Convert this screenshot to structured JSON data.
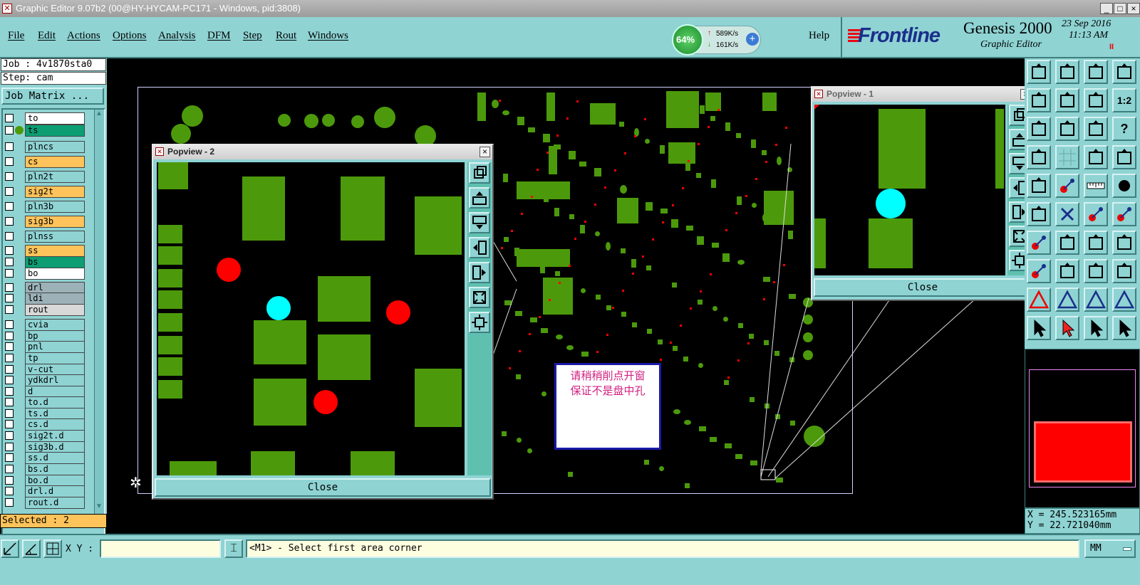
{
  "window": {
    "title": "Graphic Editor 9.07b2 (00@HY-HYCAM-PC171 - Windows, pid:3808)",
    "min": "_",
    "max": "□",
    "close": "×"
  },
  "menu": {
    "items": [
      "File",
      "Edit",
      "Actions",
      "Options",
      "Analysis",
      "DFM",
      "Step",
      "Rout",
      "Windows"
    ],
    "help": "Help"
  },
  "netmeter": {
    "percent": "64%",
    "up": "589K/s",
    "down": "161K/s",
    "plus": "+"
  },
  "brand": {
    "logo": "Frontline",
    "product": "Genesis 2000",
    "subtitle": "Graphic Editor",
    "date": "23 Sep 2016",
    "time": "11:13 AM",
    "pause": "II"
  },
  "job": {
    "job_label": "Job : 4v1870sta0",
    "step_label": "Step: cam",
    "matrix_button": "Job Matrix ..."
  },
  "layers": [
    {
      "name": "to",
      "color": "#ffffff"
    },
    {
      "name": "ts",
      "color": "#0d9e73"
    },
    {
      "name": "plncs",
      "color": "#8fd3d3"
    },
    {
      "name": "cs",
      "color": "#fec35a"
    },
    {
      "name": "pln2t",
      "color": "#8fd3d3"
    },
    {
      "name": "sig2t",
      "color": "#fec35a"
    },
    {
      "name": "pln3b",
      "color": "#8fd3d3"
    },
    {
      "name": "sig3b",
      "color": "#fec35a"
    },
    {
      "name": "plnss",
      "color": "#8fd3d3"
    },
    {
      "name": "ss",
      "color": "#fec35a"
    },
    {
      "name": "bs",
      "color": "#0d9e73"
    },
    {
      "name": "bo",
      "color": "#ffffff"
    },
    {
      "name": "drl",
      "color": "#9cb2b8"
    },
    {
      "name": "ldi",
      "color": "#9cb2b8"
    },
    {
      "name": "rout",
      "color": "#d8d8d8"
    },
    {
      "name": "cvia",
      "color": "#8fd3d3"
    },
    {
      "name": "bp",
      "color": "#8fd3d3"
    },
    {
      "name": "pnl",
      "color": "#8fd3d3"
    },
    {
      "name": "tp",
      "color": "#8fd3d3"
    },
    {
      "name": "v-cut",
      "color": "#8fd3d3"
    },
    {
      "name": "ydkdrl",
      "color": "#8fd3d3"
    },
    {
      "name": "d",
      "color": "#8fd3d3"
    },
    {
      "name": "to.d",
      "color": "#8fd3d3"
    },
    {
      "name": "ts.d",
      "color": "#8fd3d3"
    },
    {
      "name": "cs.d",
      "color": "#8fd3d3"
    },
    {
      "name": "sig2t.d",
      "color": "#8fd3d3"
    },
    {
      "name": "sig3b.d",
      "color": "#8fd3d3"
    },
    {
      "name": "ss.d",
      "color": "#8fd3d3"
    },
    {
      "name": "bs.d",
      "color": "#8fd3d3"
    },
    {
      "name": "bo.d",
      "color": "#8fd3d3"
    },
    {
      "name": "drl.d",
      "color": "#8fd3d3"
    },
    {
      "name": "rout.d",
      "color": "#8fd3d3"
    }
  ],
  "selected": "Selected : 2",
  "popview2": {
    "title": "Popview - 2",
    "close": "Close",
    "x": "×"
  },
  "popview1": {
    "title": "Popview - 1",
    "close": "Close",
    "x": "×"
  },
  "annotation": {
    "line1": "请稍稍削点开窗",
    "line2": "保证不是盘中孔"
  },
  "coords": {
    "x": "X = 245.523165mm",
    "y": "Y = 22.721040mm"
  },
  "statusbar": {
    "xy_label": "X Y :",
    "xy_value": "",
    "prompt": "<M1> - Select first area corner",
    "units": "MM"
  },
  "toolbar": {
    "ratio_label": "1:2",
    "help_label": "?"
  }
}
